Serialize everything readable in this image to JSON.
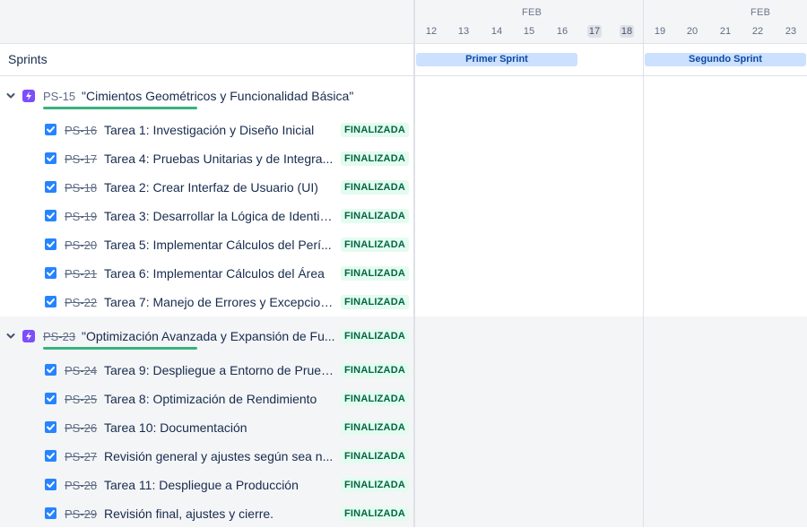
{
  "sprints_header": {
    "label": "Sprints"
  },
  "timeline": {
    "months": [
      "FEB",
      "FEB"
    ],
    "days": [
      "12",
      "13",
      "14",
      "15",
      "16",
      "17",
      "18",
      "19",
      "20",
      "21",
      "22",
      "23"
    ],
    "weekend_days": [
      "17",
      "18"
    ]
  },
  "sprint_bars": [
    "Primer Sprint",
    "Segundo Sprint"
  ],
  "epics": [
    {
      "key": "PS-15",
      "title": "\"Cimientos Geométricos y Funcionalidad Básica\"",
      "status": "",
      "key_done": false,
      "progress": 1.0,
      "icon": "lightning-icon",
      "issues": [
        {
          "key": "PS-16",
          "title": "Tarea 1: Investigación y Diseño Inicial",
          "status": "FINALIZADA"
        },
        {
          "key": "PS-17",
          "title": "Tarea 4: Pruebas Unitarias y de Integra...",
          "status": "FINALIZADA"
        },
        {
          "key": "PS-18",
          "title": "Tarea 2: Crear Interfaz de Usuario (UI)",
          "status": "FINALIZADA"
        },
        {
          "key": "PS-19",
          "title": "Tarea 3: Desarrollar la Lógica de Identifi...",
          "status": "FINALIZADA"
        },
        {
          "key": "PS-20",
          "title": "Tarea 5: Implementar Cálculos del Perí...",
          "status": "FINALIZADA"
        },
        {
          "key": "PS-21",
          "title": "Tarea 6: Implementar Cálculos del Área",
          "status": "FINALIZADA"
        },
        {
          "key": "PS-22",
          "title": "Tarea 7: Manejo de Errores y Excepcion...",
          "status": "FINALIZADA"
        }
      ]
    },
    {
      "key": "PS-23",
      "title": "\"Optimización Avanzada y Expansión de Fu...",
      "status": "FINALIZADA",
      "key_done": true,
      "progress": 1.0,
      "icon": "lightning-icon",
      "issues": [
        {
          "key": "PS-24",
          "title": "Tarea 9: Despliegue a Entorno de Prueb...",
          "status": "FINALIZADA"
        },
        {
          "key": "PS-25",
          "title": "Tarea 8: Optimización de Rendimiento",
          "status": "FINALIZADA"
        },
        {
          "key": "PS-26",
          "title": "Tarea 10: Documentación",
          "status": "FINALIZADA"
        },
        {
          "key": "PS-27",
          "title": "Revisión general y ajustes según sea n...",
          "status": "FINALIZADA"
        },
        {
          "key": "PS-28",
          "title": "Tarea 11: Despliegue a Producción",
          "status": "FINALIZADA"
        },
        {
          "key": "PS-29",
          "title": "Revisión final, ajustes y cierre.",
          "status": "FINALIZADA"
        }
      ]
    }
  ],
  "colors": {
    "accent": "#2684ff",
    "epic": "#7c4dff",
    "done_badge_bg": "#e3fcef",
    "done_badge_text": "#006644",
    "sprint_bar": "#cce0ff",
    "progress": "#36b37e"
  }
}
